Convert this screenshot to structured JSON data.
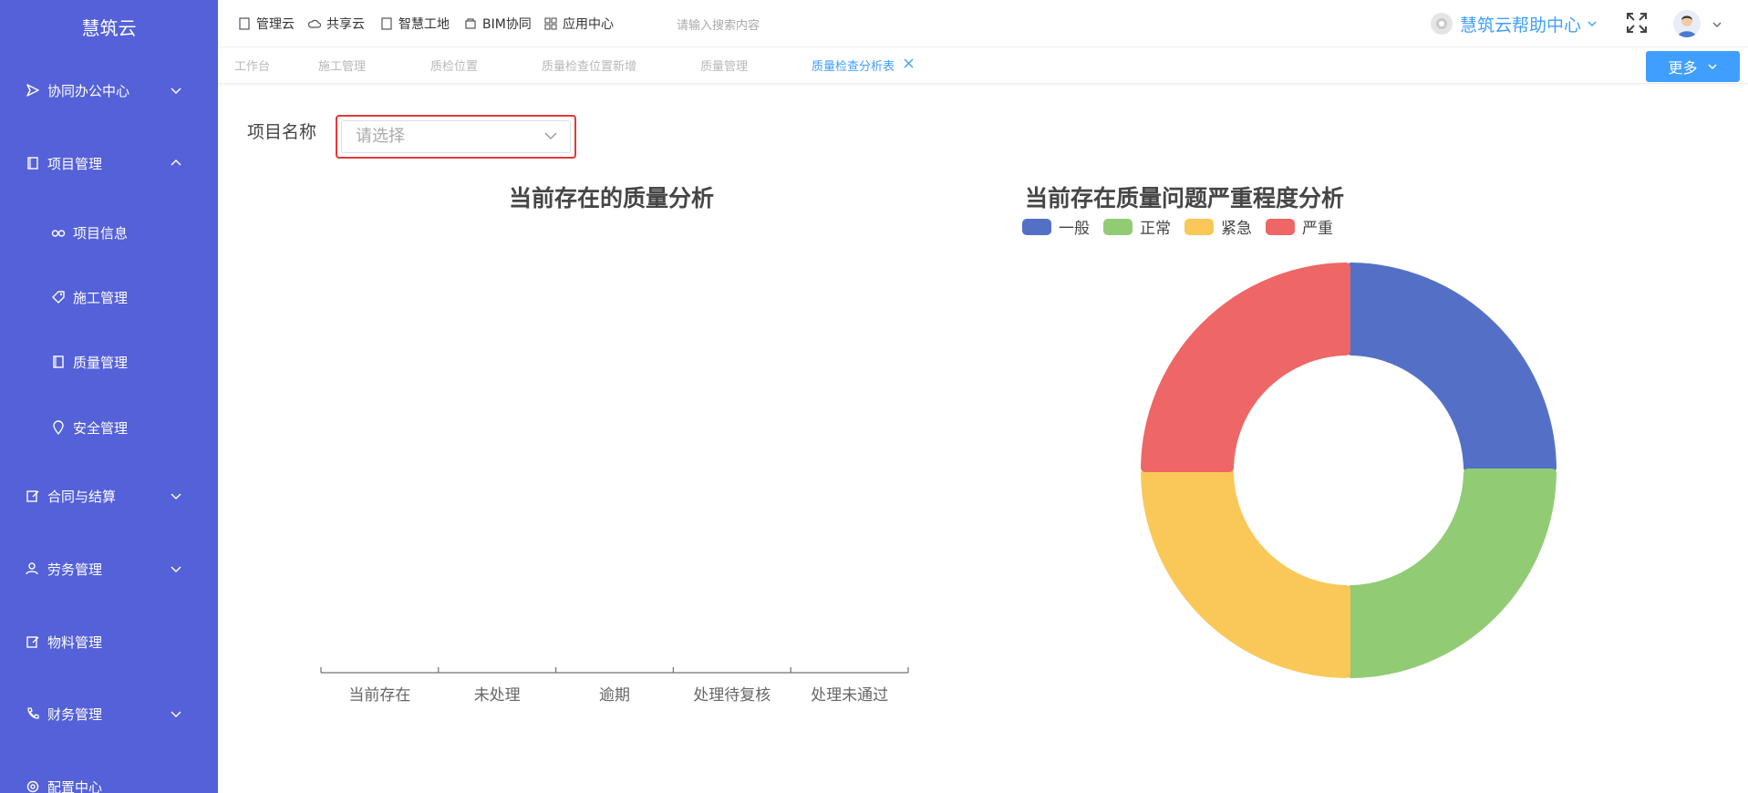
{
  "sidebar": {
    "brand": "慧筑云",
    "items": [
      {
        "label": "协同办公中心"
      },
      {
        "label": "项目管理"
      },
      {
        "label": "项目信息"
      },
      {
        "label": "施工管理"
      },
      {
        "label": "质量管理"
      },
      {
        "label": "安全管理"
      },
      {
        "label": "合同与结算"
      },
      {
        "label": "劳务管理"
      },
      {
        "label": "物料管理"
      },
      {
        "label": "财务管理"
      },
      {
        "label": "配置中心"
      }
    ]
  },
  "topbar": {
    "nav": [
      "管理云",
      "共享云",
      "智慧工地",
      "BIM协同",
      "应用中心"
    ],
    "search_placeholder": "请输入搜索内容",
    "help_label": "慧筑云帮助中心"
  },
  "tabs": [
    {
      "label": "工作台"
    },
    {
      "label": "施工管理"
    },
    {
      "label": "质检位置"
    },
    {
      "label": "质量检查位置新增"
    },
    {
      "label": "质量管理"
    },
    {
      "label": "质量检查分析表",
      "active": true
    }
  ],
  "more_button": "更多",
  "filter": {
    "label": "项目名称",
    "placeholder": "请选择"
  },
  "colors": {
    "sidebar": "#5461d8",
    "accent": "#409eff",
    "general": "#5470c6",
    "normal": "#91cc75",
    "urgent": "#fac858",
    "severe": "#ee6666"
  },
  "chart_data": [
    {
      "type": "bar",
      "title": "当前存在的质量分析",
      "categories": [
        "当前存在",
        "未处理",
        "逾期",
        "处理待复核",
        "处理未通过"
      ],
      "values": []
    },
    {
      "type": "pie",
      "title": "当前存在质量问题严重程度分析",
      "legend_position": "top",
      "slices": [
        {
          "name": "一般",
          "value": 1,
          "color": "#5470c6"
        },
        {
          "name": "正常",
          "value": 1,
          "color": "#91cc75"
        },
        {
          "name": "紧急",
          "value": 1,
          "color": "#fac858"
        },
        {
          "name": "严重",
          "value": 1,
          "color": "#ee6666"
        }
      ]
    }
  ]
}
